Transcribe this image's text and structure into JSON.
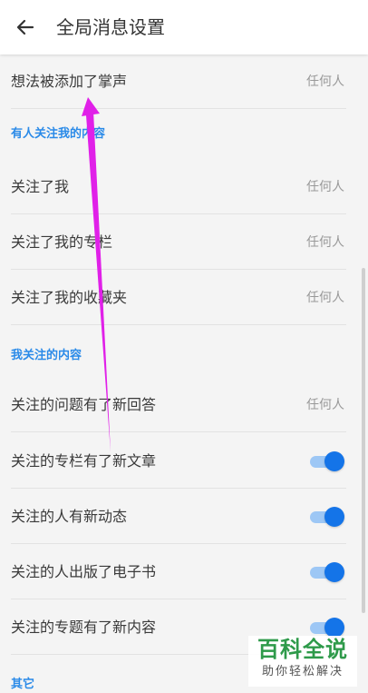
{
  "header": {
    "title": "全局消息设置",
    "back_icon": "arrow-left-icon"
  },
  "rows_top": [
    {
      "label": "想法被添加了掌声",
      "value": "任何人"
    }
  ],
  "section_followed_content": {
    "title": "有人关注我的内容",
    "rows": [
      {
        "label": "关注了我",
        "value": "任何人"
      },
      {
        "label": "关注了我的专栏",
        "value": "任何人"
      },
      {
        "label": "关注了我的收藏夹",
        "value": "任何人"
      }
    ]
  },
  "section_my_follows": {
    "title": "我关注的内容",
    "rows": [
      {
        "label": "关注的问题有了新回答",
        "value": "任何人"
      },
      {
        "label": "关注的专栏有了新文章",
        "toggle": true
      },
      {
        "label": "关注的人有新动态",
        "toggle": true
      },
      {
        "label": "关注的人出版了电子书",
        "toggle": true
      },
      {
        "label": "关注的专题有了新内容",
        "toggle": true
      }
    ]
  },
  "section_other": {
    "title": "其它"
  },
  "watermark": {
    "main": "百科全说",
    "sub": "助你轻松解决"
  },
  "colors": {
    "accent": "#2a8ae8",
    "toggle_on": "#1474e8",
    "annotation_arrow": "#e020e8",
    "watermark_green": "#2e9a4a"
  }
}
